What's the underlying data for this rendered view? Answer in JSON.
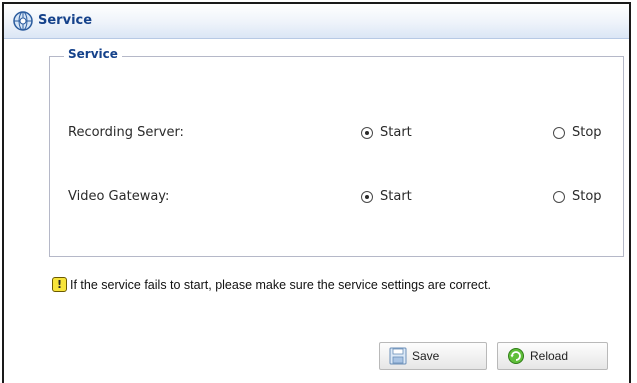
{
  "panel": {
    "title": "Service",
    "icon": "service-globe-icon"
  },
  "fieldset": {
    "legend": "Service",
    "rows": [
      {
        "label": "Recording Server:",
        "start_label": "Start",
        "stop_label": "Stop",
        "selected": "Start"
      },
      {
        "label": "Video Gateway:",
        "start_label": "Start",
        "stop_label": "Stop",
        "selected": "Start"
      }
    ]
  },
  "note": {
    "icon": "warning-icon",
    "text": "If the service fails to start, please make sure the service settings are correct."
  },
  "buttons": {
    "save_label": "Save",
    "reload_label": "Reload"
  },
  "colors": {
    "title": "#15428b",
    "header_gradient_end": "#dbe6f5",
    "warning": "#f7e43a"
  }
}
